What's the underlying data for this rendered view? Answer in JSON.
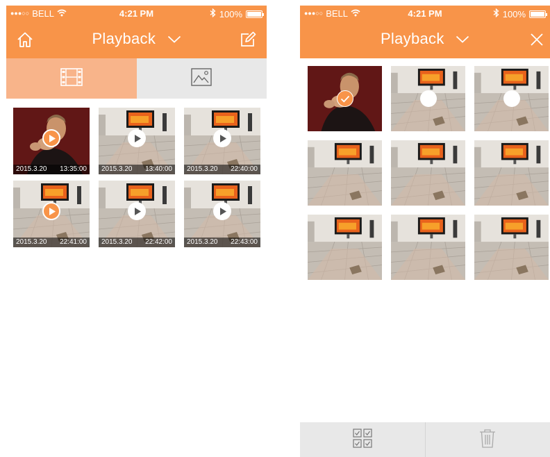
{
  "colors": {
    "accent": "#f89449",
    "segment_active": "#f8b48a",
    "segment_inactive": "#e8e8e8"
  },
  "status_bar": {
    "carrier": "BELL",
    "time": "4:21 PM",
    "battery": "100%"
  },
  "left_screen": {
    "title": "Playback",
    "icons": [
      "home-icon",
      "chevron-down-icon",
      "edit-icon"
    ],
    "segments": [
      {
        "name": "video-tab",
        "icon": "video-film-icon",
        "active": true
      },
      {
        "name": "photo-tab",
        "icon": "image-icon",
        "active": false
      }
    ],
    "videos": [
      {
        "date": "2015.3.20",
        "time": "13:35:00",
        "scene": "person",
        "play_style": "orange"
      },
      {
        "date": "2015.3.20",
        "time": "13:40:00",
        "scene": "room",
        "play_style": "white"
      },
      {
        "date": "2015.3.20",
        "time": "22:40:00",
        "scene": "room",
        "play_style": "white"
      },
      {
        "date": "2015.3.20",
        "time": "22:41:00",
        "scene": "room",
        "play_style": "orange"
      },
      {
        "date": "2015.3.20",
        "time": "22:42:00",
        "scene": "room",
        "play_style": "white"
      },
      {
        "date": "2015.3.20",
        "time": "22:43:00",
        "scene": "room",
        "play_style": "white"
      }
    ]
  },
  "right_screen": {
    "title": "Playback",
    "icons": [
      "chevron-down-icon",
      "close-icon"
    ],
    "items": [
      {
        "scene": "person",
        "selection": "checked"
      },
      {
        "scene": "room",
        "selection": "unchecked"
      },
      {
        "scene": "room",
        "selection": "unchecked"
      },
      {
        "scene": "room",
        "selection": "none"
      },
      {
        "scene": "room",
        "selection": "none"
      },
      {
        "scene": "room",
        "selection": "none"
      },
      {
        "scene": "room",
        "selection": "none"
      },
      {
        "scene": "room",
        "selection": "none"
      },
      {
        "scene": "room",
        "selection": "none"
      }
    ],
    "bottom_bar": [
      {
        "name": "select-all-button",
        "icon": "select-all-icon"
      },
      {
        "name": "delete-button",
        "icon": "trash-icon"
      }
    ]
  }
}
